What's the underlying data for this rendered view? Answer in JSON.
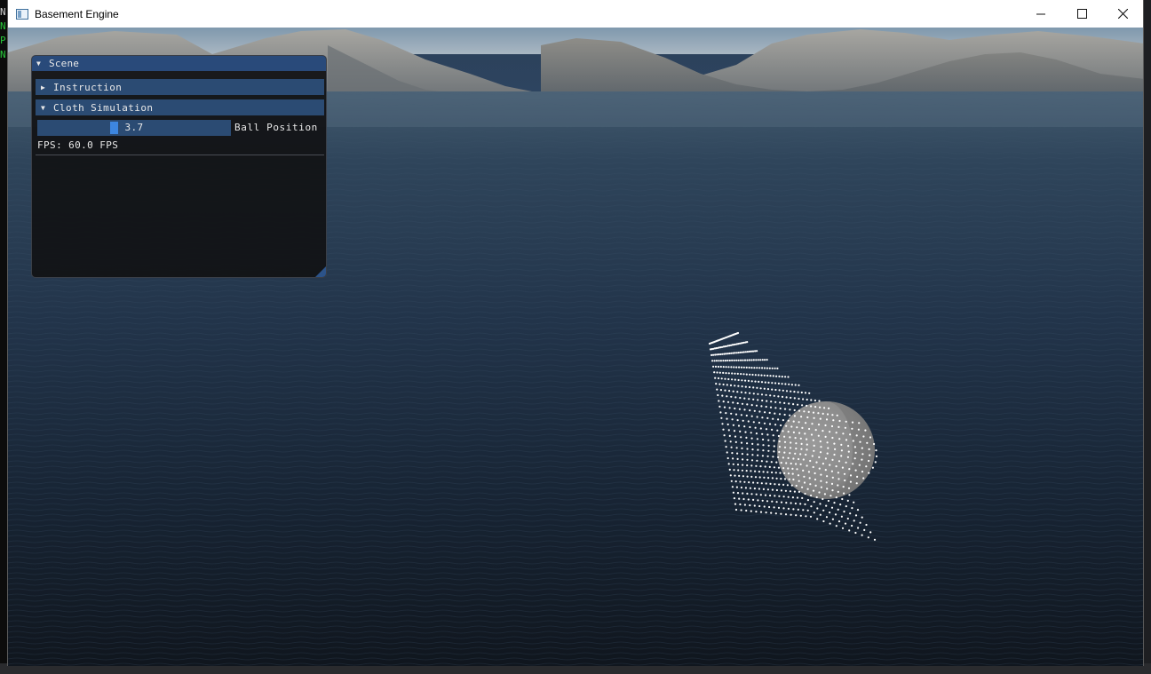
{
  "window": {
    "title": "Basement Engine",
    "controls": [
      "minimize",
      "maximize",
      "close"
    ]
  },
  "background_console": {
    "line_starts": [
      "N",
      "N",
      "P",
      "N"
    ]
  },
  "scene_panel": {
    "title": "Scene",
    "title_expanded_icon": "▼",
    "sections": [
      {
        "label": "Instruction",
        "expanded": false,
        "icon": "▶"
      },
      {
        "label": "Cloth Simulation",
        "expanded": true,
        "icon": "▼"
      }
    ],
    "slider": {
      "value": 3.7,
      "value_text": "3.7",
      "label": "Ball Position",
      "fraction": 0.39
    },
    "fps_text": "FPS: 60.0 FPS"
  },
  "colors": {
    "panel_title": "#294a7a",
    "panel_header": "#2b4b73",
    "slider_grab": "#3d86e0",
    "water": "#1e2d40",
    "mountains": "#8a8f93"
  }
}
